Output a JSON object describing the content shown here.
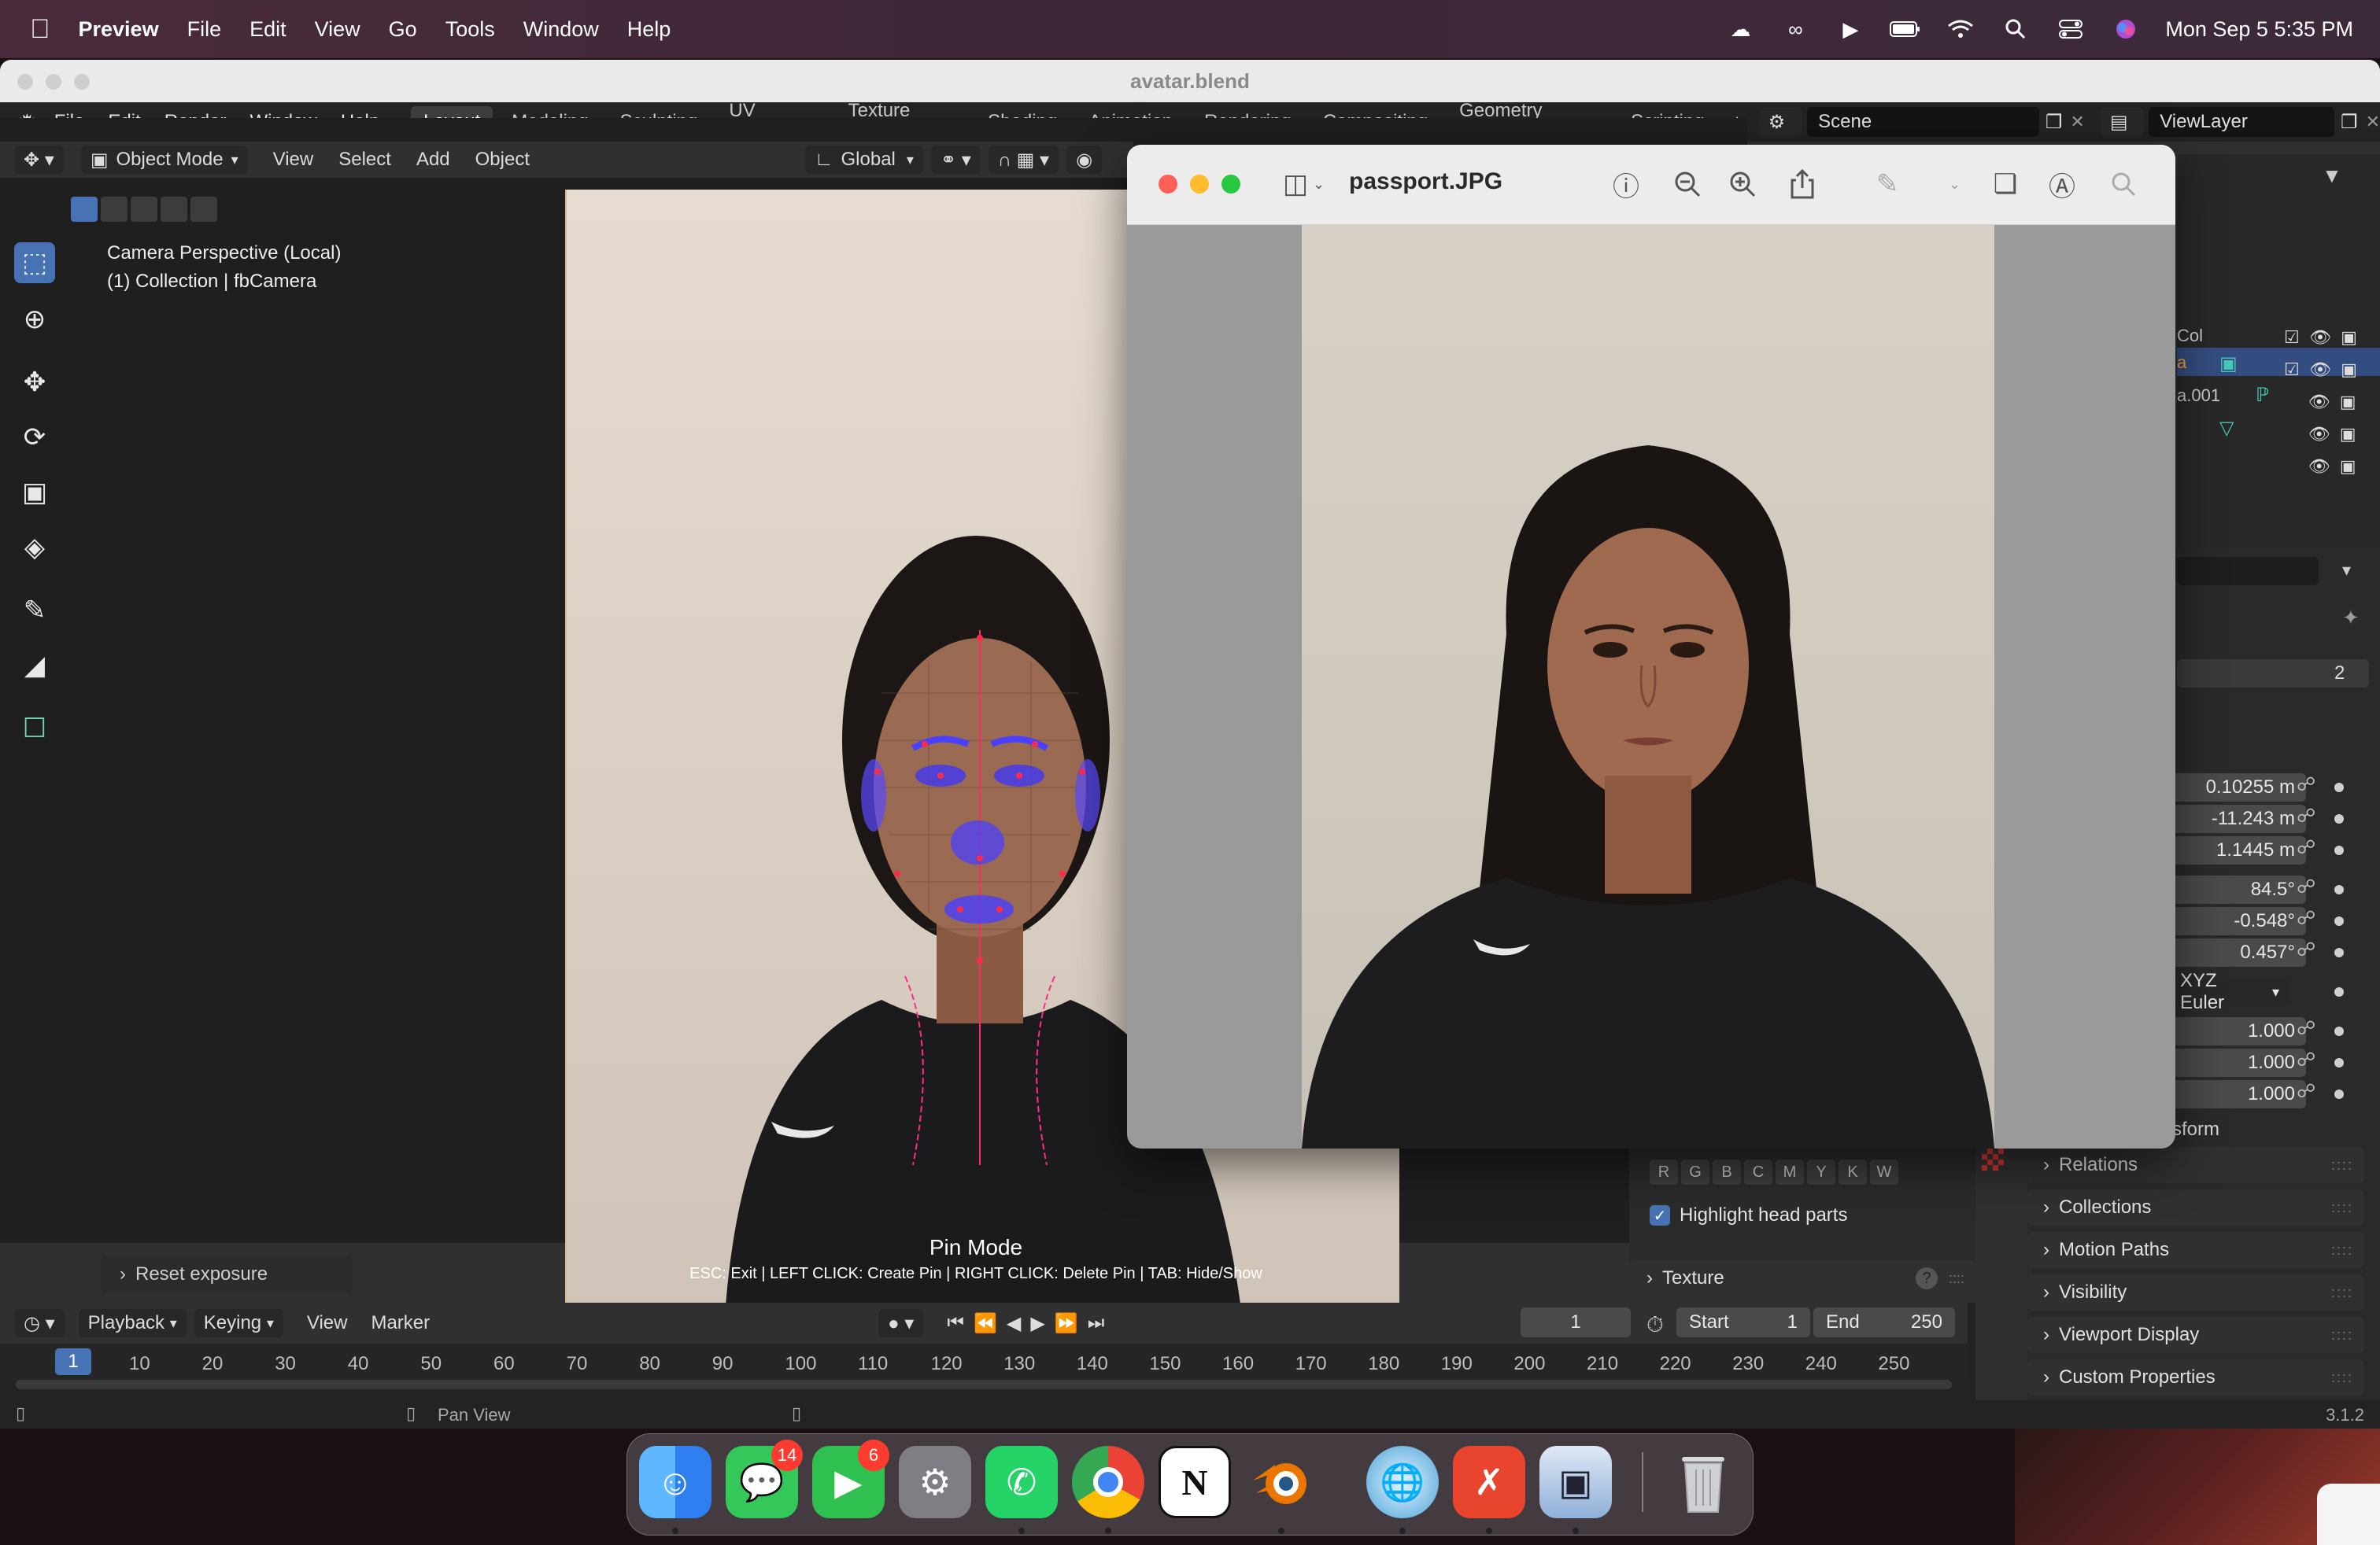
{
  "menubar": {
    "app": "Preview",
    "items": [
      "File",
      "Edit",
      "View",
      "Go",
      "Tools",
      "Window",
      "Help"
    ],
    "clock": "Mon Sep 5  5:35 PM"
  },
  "blender": {
    "title": "avatar.blend",
    "menu": [
      "File",
      "Edit",
      "Render",
      "Window",
      "Help"
    ],
    "workspaces": [
      "Layout",
      "Modeling",
      "Sculpting",
      "UV Editing",
      "Texture Paint",
      "Shading",
      "Animation",
      "Rendering",
      "Compositing",
      "Geometry Nodes",
      "Scripting"
    ],
    "scene": "Scene",
    "viewlayer": "ViewLayer",
    "viewport_header": {
      "mode": "Object Mode",
      "menus": [
        "View",
        "Select",
        "Add",
        "Object"
      ],
      "orientation": "Global"
    },
    "viewport_info": [
      "Camera Perspective (Local)",
      "(1) Collection | fbCamera"
    ],
    "pin_mode": {
      "title": "Pin Mode",
      "hint": "ESC: Exit | LEFT CLICK: Create Pin | RIGHT CLICK: Delete Pin | TAB: Hide/Show"
    },
    "reset_exposure": "Reset exposure",
    "outliner": {
      "rows": [
        "Col",
        "a",
        "a.001"
      ]
    },
    "properties": {
      "number_field": "2",
      "location": [
        "0.10255 m",
        "-11.243 m",
        "1.1445 m"
      ],
      "rotation": [
        "84.5°",
        "-0.548°",
        "0.457°"
      ],
      "rotation_mode": "XYZ Euler",
      "scale": [
        "1.000",
        "1.000",
        "1.000"
      ],
      "delta_label": "sform",
      "panels": [
        "Relations",
        "Collections",
        "Motion Paths",
        "Visibility",
        "Viewport Display",
        "Custom Properties"
      ]
    },
    "pin_panel": {
      "channels": [
        "R",
        "G",
        "B",
        "C",
        "M",
        "Y",
        "K",
        "W"
      ],
      "highlight_label": "Highlight head parts",
      "texture_label": "Texture"
    },
    "timeline": {
      "menus": [
        "Playback",
        "Keying",
        "View",
        "Marker"
      ],
      "current_frame": "1",
      "frame_field": "1",
      "start_label": "Start",
      "start": "1",
      "end_label": "End",
      "end": "250",
      "ticks": [
        "10",
        "20",
        "30",
        "40",
        "50",
        "60",
        "70",
        "80",
        "90",
        "100",
        "110",
        "120",
        "130",
        "140",
        "150",
        "160",
        "170",
        "180",
        "190",
        "200",
        "210",
        "220",
        "230",
        "240",
        "250"
      ]
    },
    "status": {
      "hint": "Pan View",
      "version": "3.1.2"
    }
  },
  "preview": {
    "title": "passport.JPG"
  },
  "dock": {
    "messages_badge": "14",
    "facetime_badge": "6",
    "notion_letter": "N"
  }
}
